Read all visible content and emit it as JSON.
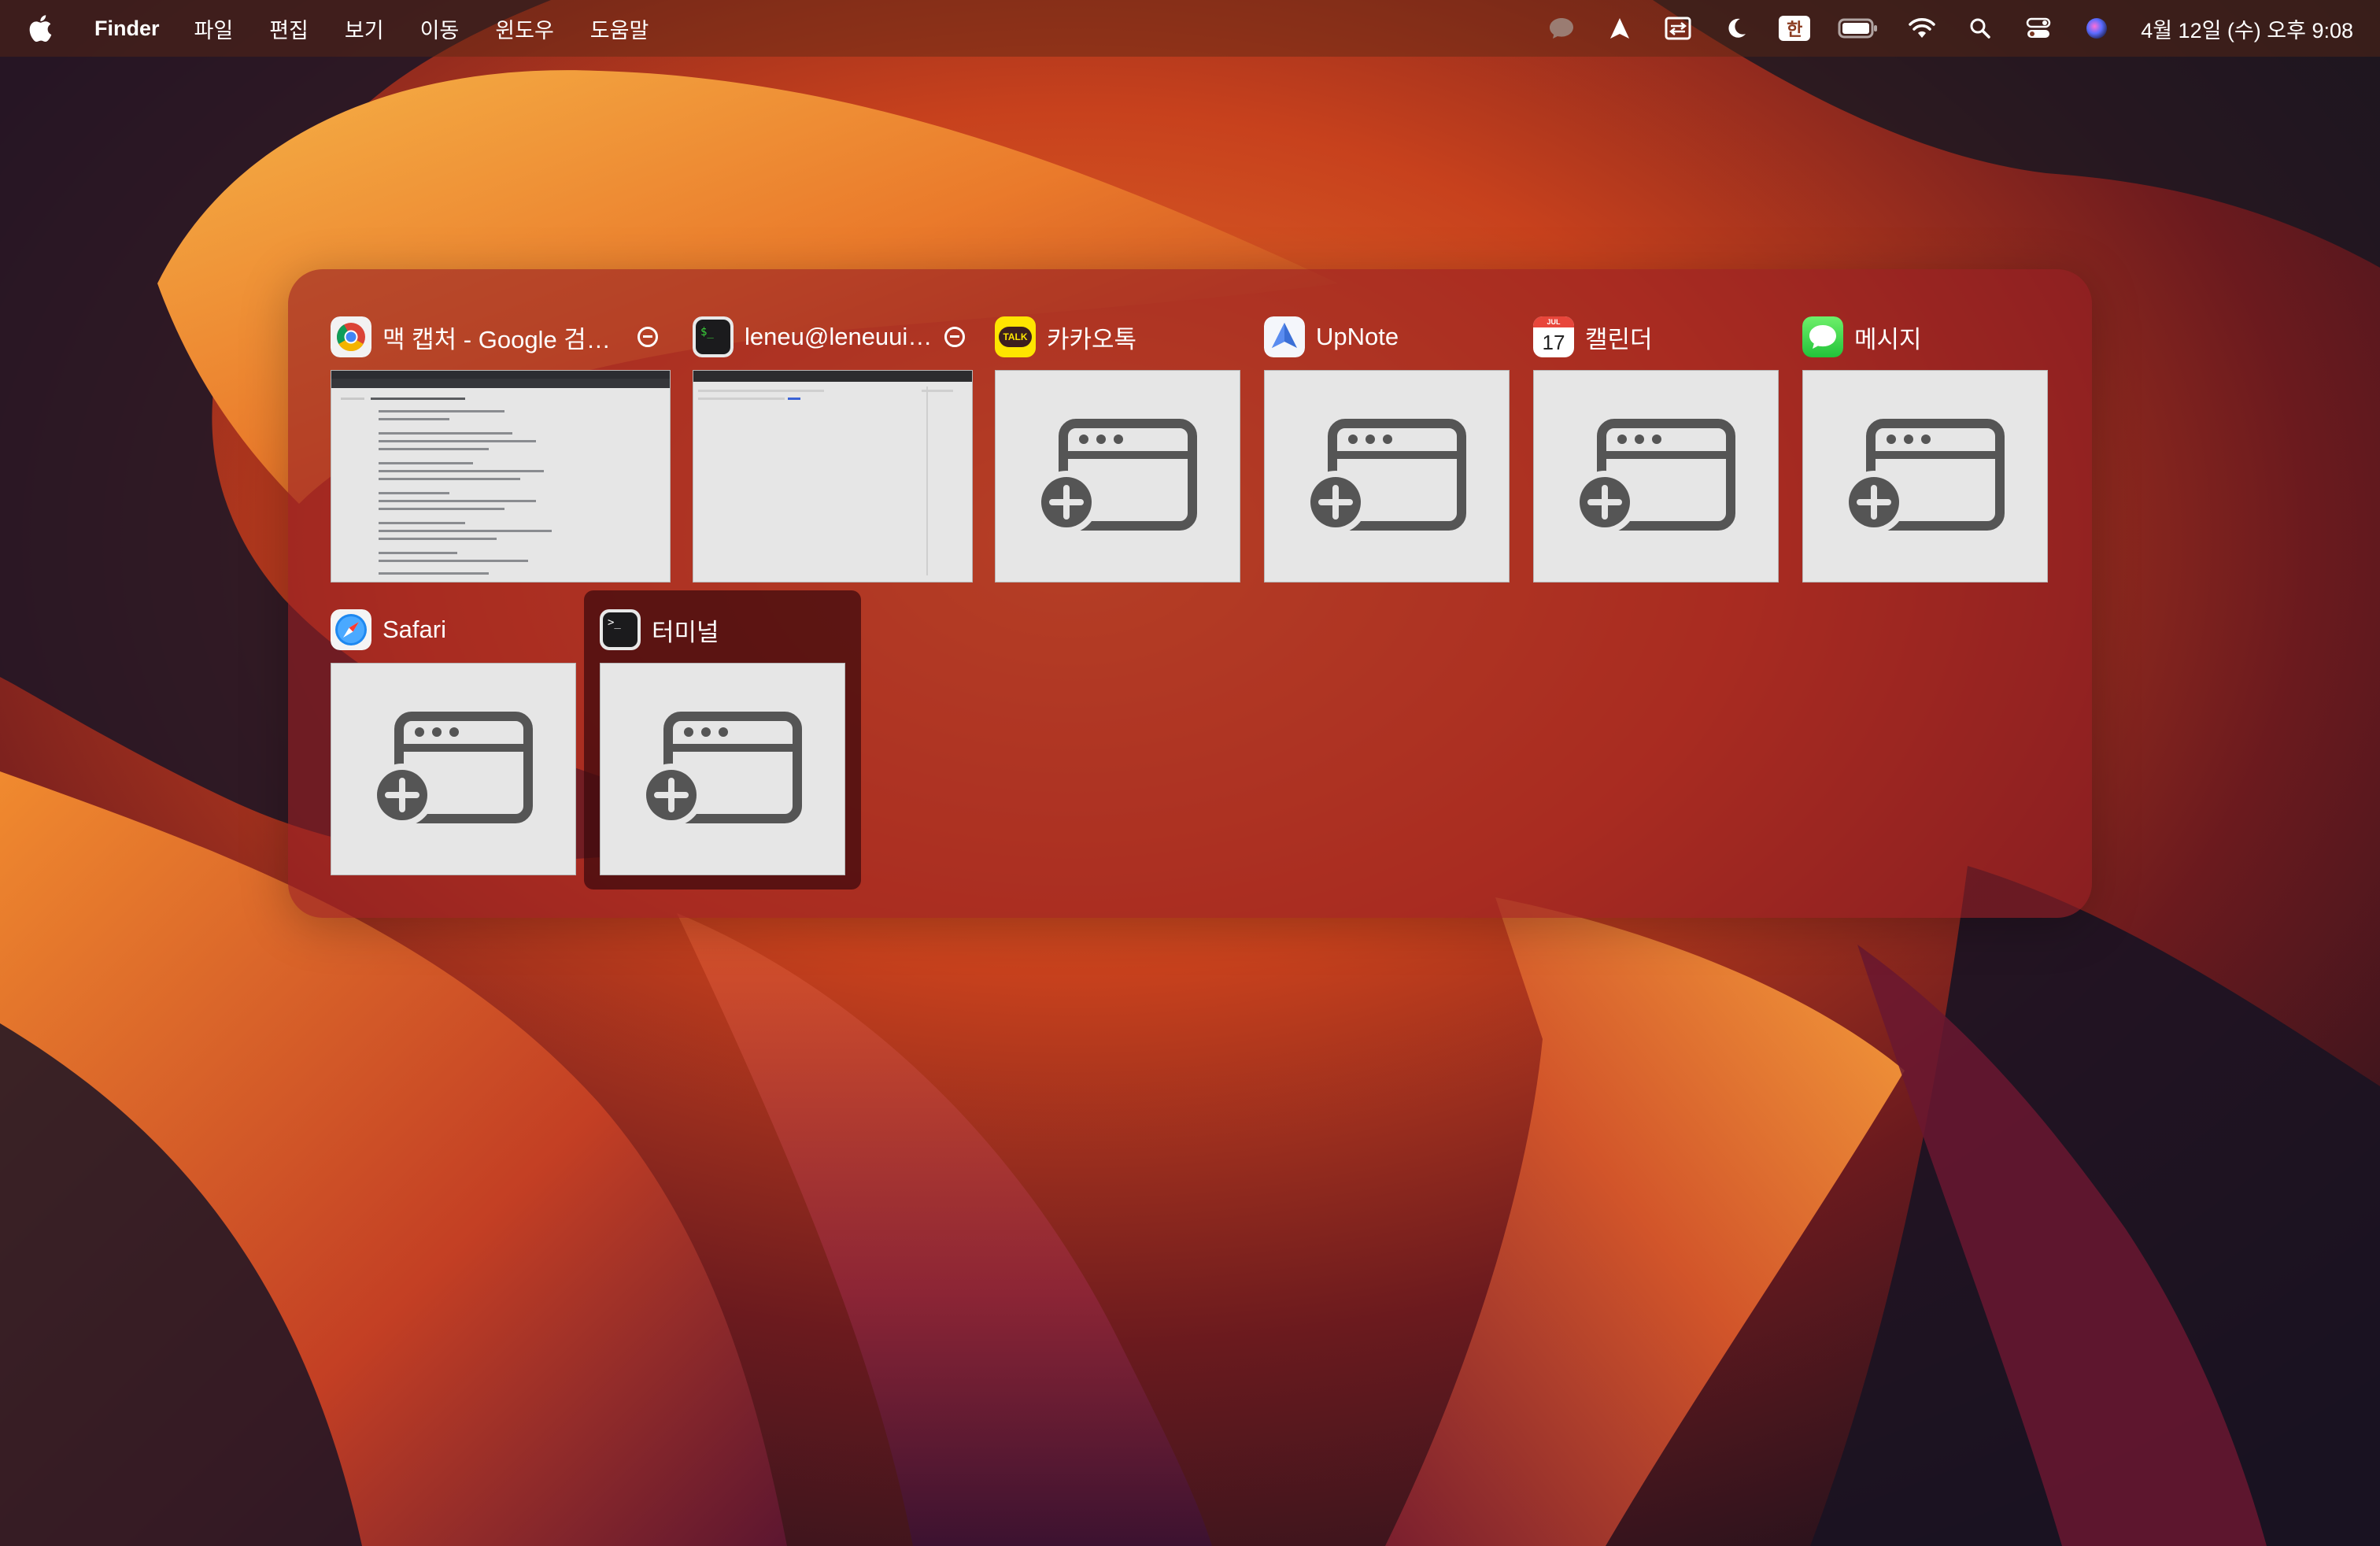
{
  "menubar": {
    "app_name": "Finder",
    "menus": [
      "파일",
      "편집",
      "보기",
      "이동",
      "윈도우",
      "도움말"
    ],
    "ime": "한",
    "clock": "4월 12일 (수) 오후 9:08"
  },
  "switcher": {
    "tiles": [
      {
        "app": "Google Chrome",
        "label": "맥 캡처 - Google 검색...",
        "icon": "chrome-icon",
        "has_close": true
      },
      {
        "app": "Terminal",
        "label": "leneu@leneuui-...",
        "icon": "terminal-icon",
        "has_close": true
      },
      {
        "app": "KakaoTalk",
        "label": "카카오톡",
        "icon": "kakaotalk-icon",
        "has_close": false
      },
      {
        "app": "UpNote",
        "label": "UpNote",
        "icon": "upnote-icon",
        "has_close": false
      },
      {
        "app": "Calendar",
        "label": "캘린더",
        "icon": "calendar-icon",
        "has_close": false,
        "icon_month": "JUL",
        "icon_day": "17"
      },
      {
        "app": "Messages",
        "label": "메시지",
        "icon": "messages-icon",
        "has_close": false
      },
      {
        "app": "Safari",
        "label": "Safari",
        "icon": "safari-icon",
        "has_close": false
      },
      {
        "app": "Terminal",
        "label": "터미널",
        "icon": "terminal-icon",
        "has_close": false,
        "selected": true
      }
    ],
    "kakao_icon_text": "TALK",
    "terminal_icon_text": ">_"
  },
  "colors": {
    "panel": "#96201f",
    "placeholder_bg": "#e6e6e6",
    "placeholder_icon": "#555555"
  }
}
